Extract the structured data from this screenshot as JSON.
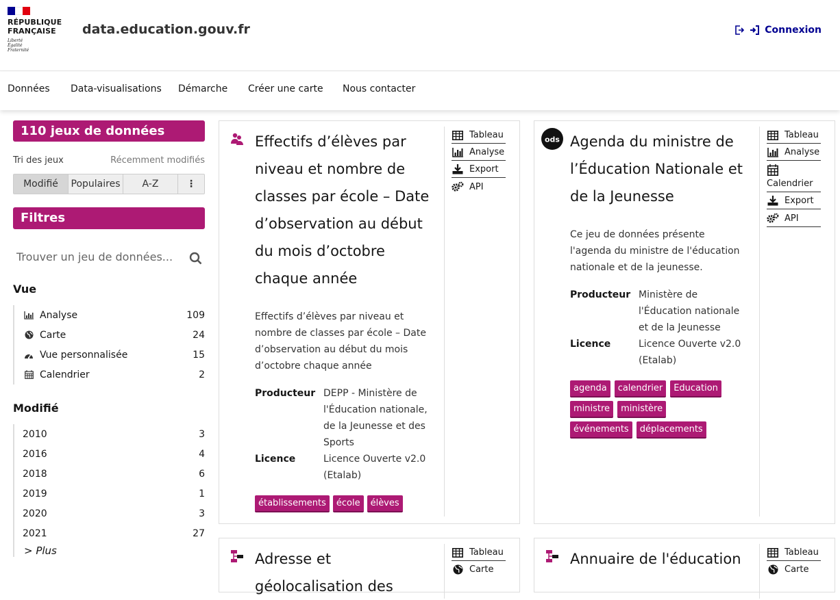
{
  "header": {
    "republique_line1": "RÉPUBLIQUE",
    "republique_line2": "FRANÇAISE",
    "devise": [
      "Liberté",
      "Égalité",
      "Fraternité"
    ],
    "site_title": "data.education.gouv.fr",
    "login_label": "Connexion",
    "flag_colors": [
      "#000091",
      "#ffffff",
      "#e1000f"
    ]
  },
  "nav": {
    "items": [
      "Données",
      "Data-visualisations",
      "Démarche",
      "Créer une carte",
      "Nous contacter"
    ]
  },
  "sidebar": {
    "count_label": "110 jeux de données",
    "sort_label": "Tri des jeux",
    "sort_value": "Récemment modifiés",
    "sort_tabs": [
      "Modifié",
      "Populaires",
      "A-Z",
      "⋮"
    ],
    "filters_label": "Filtres",
    "search_placeholder": "Trouver un jeu de données...",
    "vue_title": "Vue",
    "vue_items": [
      {
        "label": "Analyse",
        "count": "109",
        "icon": "bar-chart-icon"
      },
      {
        "label": "Carte",
        "count": "24",
        "icon": "globe-icon"
      },
      {
        "label": "Vue personnalisée",
        "count": "15",
        "icon": "dashboard-icon"
      },
      {
        "label": "Calendrier",
        "count": "2",
        "icon": "calendar-icon"
      }
    ],
    "modifie_title": "Modifié",
    "modifie_items": [
      {
        "label": "2010",
        "count": "3"
      },
      {
        "label": "2016",
        "count": "4"
      },
      {
        "label": "2018",
        "count": "6"
      },
      {
        "label": "2019",
        "count": "1"
      },
      {
        "label": "2020",
        "count": "3"
      },
      {
        "label": "2021",
        "count": "27"
      }
    ],
    "more_label": "> Plus"
  },
  "cards": [
    {
      "title": "Effectifs d’élèves par niveau et nombre de classes par école – Date d’observation au début du mois d’octobre chaque année",
      "description": "Effectifs d’élèves par niveau et nombre de classes par école – Date d’observation au début du mois d’octobre chaque année",
      "producteur_label": "Producteur",
      "producteur": "DEPP - Ministère de l'Éducation nationale, de la Jeunesse et des Sports",
      "licence_label": "Licence",
      "licence": "Licence Ouverte v2.0 (Etalab)",
      "tags": [
        "établissements",
        "école",
        "élèves"
      ],
      "actions": [
        "Tableau",
        "Analyse",
        "Export",
        "API"
      ]
    },
    {
      "title": "Agenda du ministre de l’Éducation Nationale et de la Jeunesse",
      "description": "Ce jeu de données présente l'agenda du ministre de l'éducation nationale et de la jeunesse.",
      "producteur_label": "Producteur",
      "producteur": "Ministère de l'Éducation nationale et de la Jeunesse",
      "licence_label": "Licence",
      "licence": "Licence Ouverte v2.0 (Etalab)",
      "tags": [
        "agenda",
        "calendrier",
        "Education",
        "ministre",
        "ministère",
        "événements",
        "déplacements"
      ],
      "actions": [
        "Tableau",
        "Analyse",
        "Calendrier",
        "Export",
        "API"
      ],
      "logo_text": "ods"
    },
    {
      "title": "Adresse et géolocalisation des",
      "actions": [
        "Tableau",
        "Carte"
      ]
    },
    {
      "title": "Annuaire de l'éducation",
      "actions": [
        "Tableau",
        "Carte"
      ]
    }
  ],
  "colors": {
    "accent": "#ad1a74",
    "link": "#000091"
  }
}
